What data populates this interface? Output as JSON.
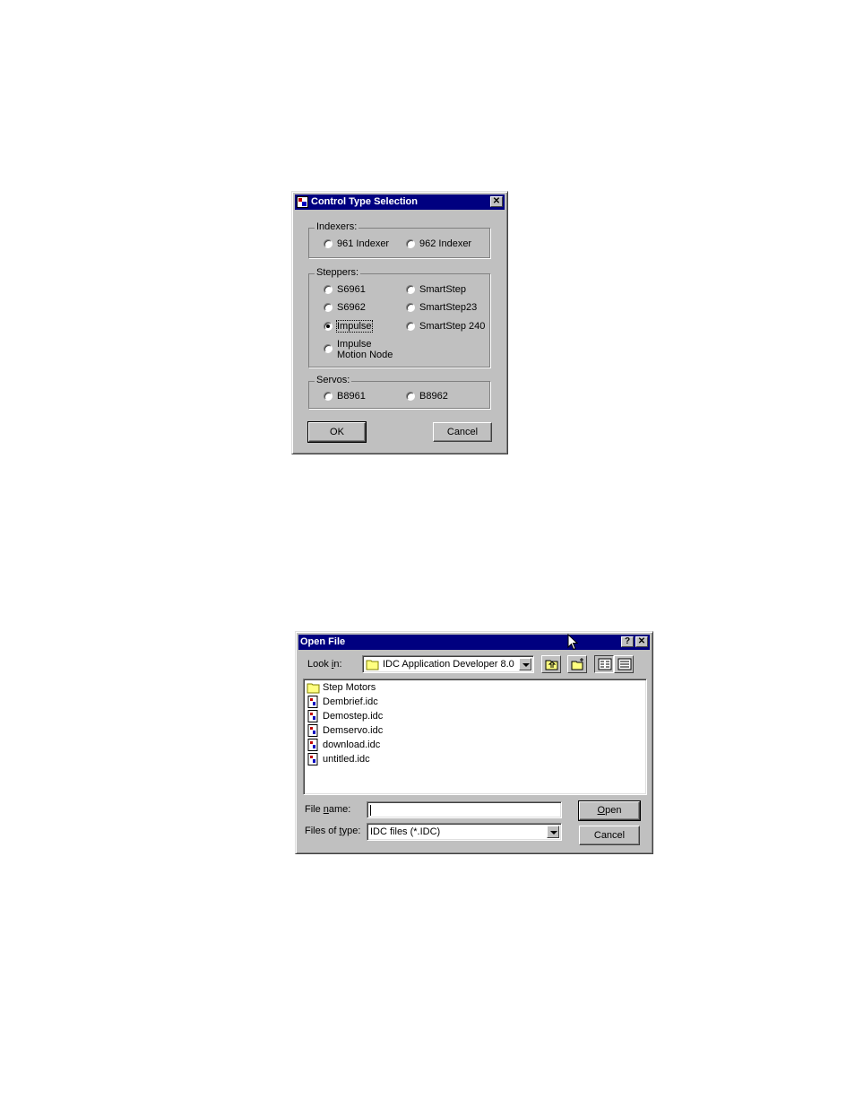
{
  "control_dialog": {
    "title": "Control Type Selection",
    "close_glyph": "✕",
    "groups": {
      "indexers": {
        "label": "Indexers:",
        "options": [
          "961 Indexer",
          "962 Indexer"
        ]
      },
      "steppers": {
        "label": "Steppers:",
        "options": [
          "S6961",
          "SmartStep",
          "S6962",
          "SmartStep23",
          "Impulse",
          "SmartStep 240",
          "Impulse Motion Node"
        ]
      },
      "servos": {
        "label": "Servos:",
        "options": [
          "B8961",
          "B8962"
        ]
      }
    },
    "selected_option": "Impulse",
    "ok_label": "OK",
    "cancel_label": "Cancel"
  },
  "open_dialog": {
    "title": "Open File",
    "help_glyph": "?",
    "close_glyph": "✕",
    "look_in_label": "Look in:",
    "look_in_accel": "i",
    "look_in_value": "IDC Application Developer 8.0",
    "files": [
      {
        "name": "Step Motors",
        "icon": "folder-icon"
      },
      {
        "name": "Dembrief.idc",
        "icon": "idc-file-icon"
      },
      {
        "name": "Demostep.idc",
        "icon": "idc-file-icon"
      },
      {
        "name": "Demservo.idc",
        "icon": "idc-file-icon"
      },
      {
        "name": "download.idc",
        "icon": "idc-file-icon"
      },
      {
        "name": "untitled.idc",
        "icon": "idc-file-icon"
      }
    ],
    "file_name_label": "File name:",
    "file_name_accel": "n",
    "file_name_value": "",
    "files_of_type_label": "Files of type:",
    "files_of_type_accel": "t",
    "files_of_type_value": "IDC files (*.IDC)",
    "open_label": "Open",
    "open_accel": "O",
    "cancel_label": "Cancel"
  }
}
